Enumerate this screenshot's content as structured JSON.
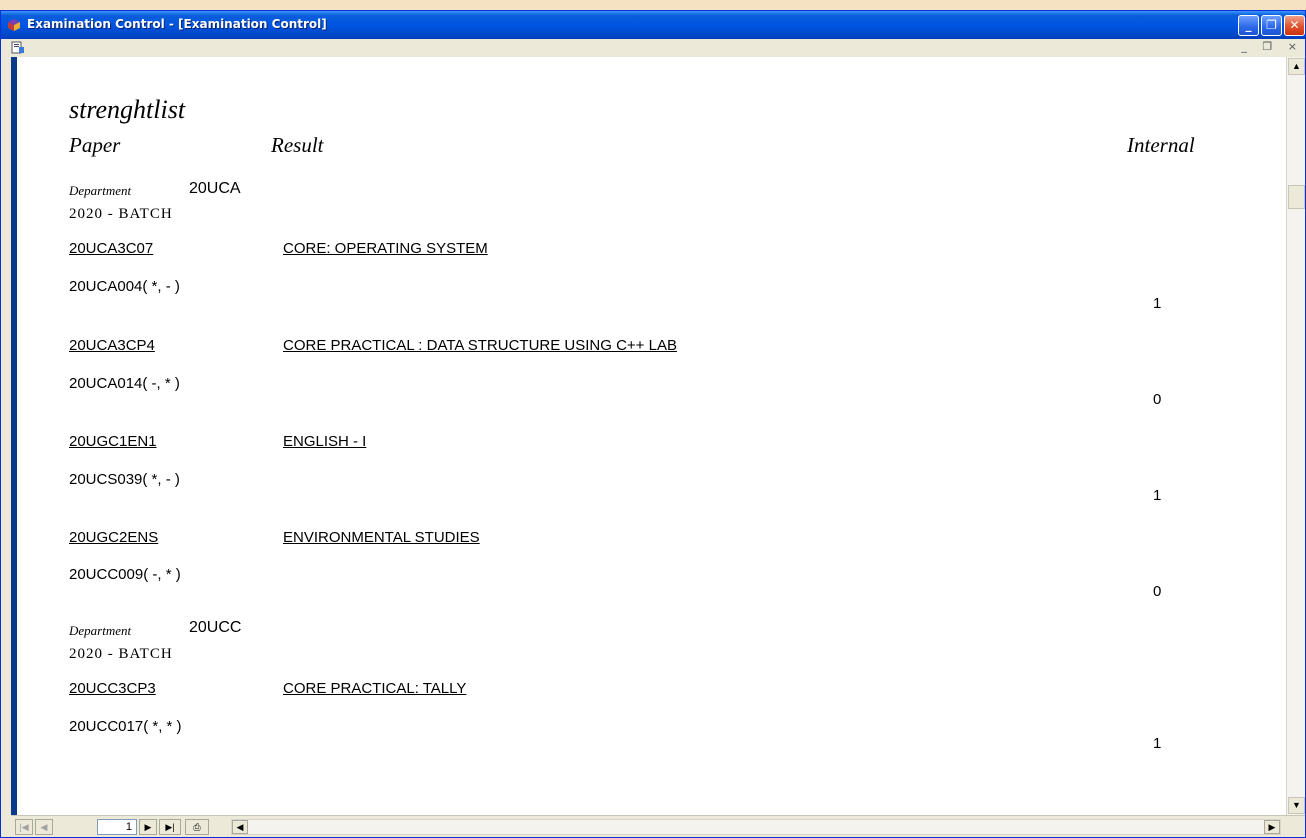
{
  "window": {
    "title": "Examination Control - [Examination Control]",
    "min_glyph": "_",
    "max_glyph": "❐",
    "close_glyph": "✕",
    "mdi_controls": "_ ❐ ×"
  },
  "report": {
    "title": "strenghtlist",
    "headers": {
      "paper": "Paper",
      "result": "Result",
      "internal": "Internal"
    },
    "groups": [
      {
        "department_label": "Department",
        "department": "20UCA",
        "batch": "2020   - BATCH",
        "papers": [
          {
            "code": "20UCA3C07",
            "name": "CORE: OPERATING SYSTEM",
            "student": "20UCA004( *, - )",
            "internal": "1"
          },
          {
            "code": "20UCA3CP4",
            "name": "CORE PRACTICAL : DATA STRUCTURE USING C++ LAB",
            "student": "20UCA014( -, * )",
            "internal": "0"
          },
          {
            "code": "20UGC1EN1",
            "name": "ENGLISH - I",
            "student": "20UCS039( *, - )",
            "internal": "1"
          },
          {
            "code": "20UGC2ENS",
            "name": "ENVIRONMENTAL  STUDIES",
            "student": "20UCC009( -, * )",
            "internal": "0"
          }
        ]
      },
      {
        "department_label": "Department",
        "department": "20UCC",
        "batch": "2020   - BATCH",
        "papers": [
          {
            "code": "20UCC3CP3",
            "name": "CORE PRACTICAL: TALLY",
            "student": "20UCC017( *, * )",
            "internal": "1"
          }
        ]
      }
    ]
  },
  "navigation": {
    "page_number": "1",
    "first_icon": "first-page-icon",
    "prev_icon": "prev-page-icon",
    "next_icon": "next-page-icon",
    "last_icon": "last-page-icon",
    "print_icon": "print-icon"
  },
  "colors": {
    "titlebar": "#0054e3",
    "viewer_border": "#0a3a8a",
    "close_button": "#e0512c"
  }
}
